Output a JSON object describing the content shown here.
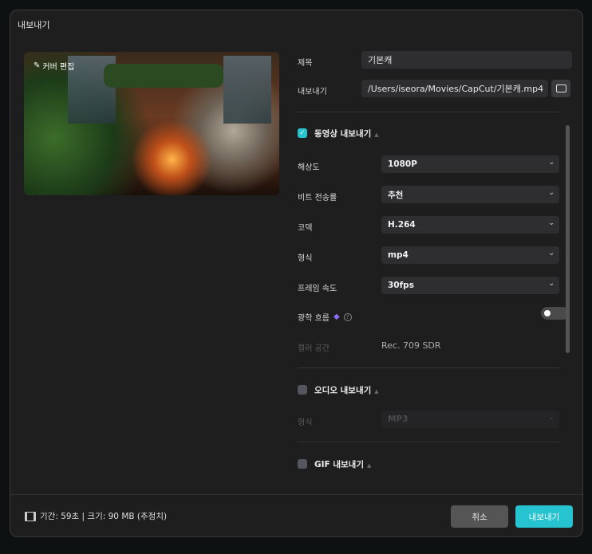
{
  "dialog_title": "내보내기",
  "cover_edit": "커버 편집",
  "fields": {
    "title_label": "제목",
    "title_value": "기본캐",
    "export_label": "내보내기",
    "export_path": "/Users/iseora/Movies/CapCut/기본캐.mp4"
  },
  "video": {
    "section_label": "동영상 내보내기",
    "checked": true,
    "rows": [
      {
        "label": "해상도",
        "value": "1080P"
      },
      {
        "label": "비트 전송률",
        "value": "추천"
      },
      {
        "label": "코덱",
        "value": "H.264"
      },
      {
        "label": "형식",
        "value": "mp4"
      },
      {
        "label": "프레임 속도",
        "value": "30fps"
      }
    ],
    "optical_flow_label": "광학 흐름",
    "optical_flow_on": false,
    "color_space_label": "컬러 공간",
    "color_space_value": "Rec. 709 SDR"
  },
  "audio": {
    "section_label": "오디오 내보내기",
    "checked": false,
    "format_label": "형식",
    "format_value": "MP3"
  },
  "gif": {
    "section_label": "GIF 내보내기",
    "checked": false
  },
  "footer": {
    "info": "기간: 59초 | 크기: 90 MB (추정치)",
    "cancel": "취소",
    "export": "내보내기"
  },
  "colors": {
    "accent": "#26c3d0",
    "premium": "#8b6cf6"
  }
}
